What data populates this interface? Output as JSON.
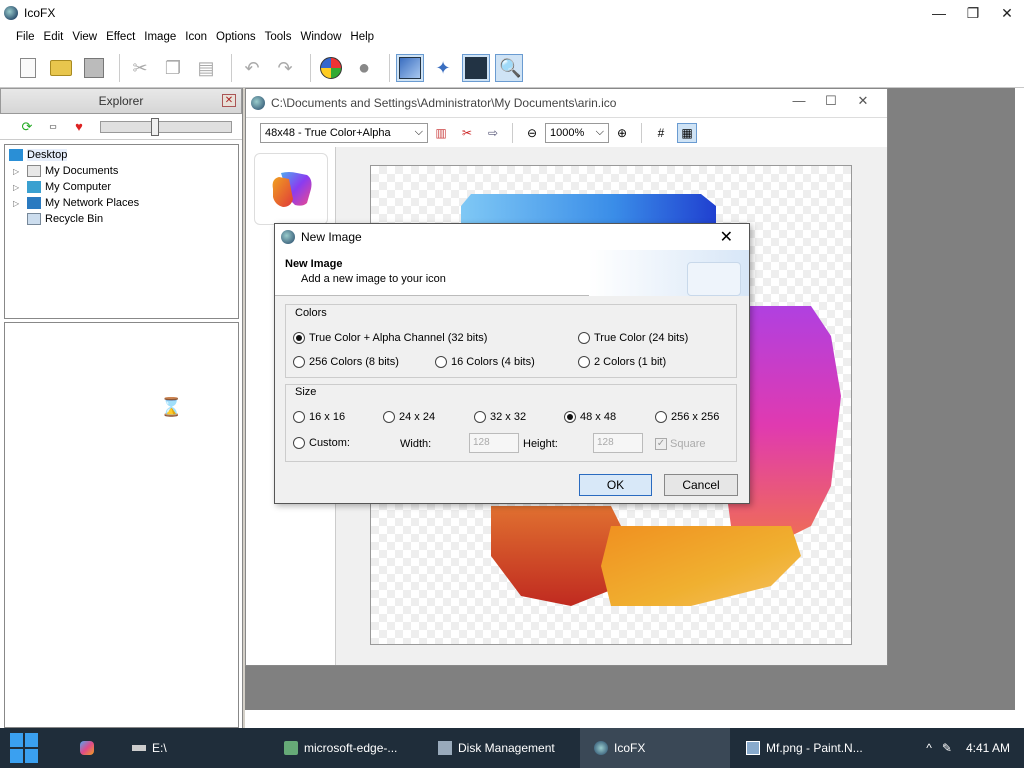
{
  "app": {
    "title": "IcoFX",
    "window_controls": {
      "minimize": "—",
      "maximize": "❐",
      "close": "✕"
    }
  },
  "menu": [
    "File",
    "Edit",
    "View",
    "Effect",
    "Image",
    "Icon",
    "Options",
    "Tools",
    "Window",
    "Help"
  ],
  "toolbar": {
    "icons": [
      "new-icon",
      "open-icon",
      "save-icon",
      "cut-icon",
      "copy-icon",
      "paste-icon",
      "undo-icon",
      "redo-icon",
      "windows-icon",
      "apple-icon",
      "image-view-icon",
      "effect-icon",
      "capture-icon",
      "zoom-icon"
    ]
  },
  "explorer": {
    "title": "Explorer",
    "close": "✕",
    "tree": [
      {
        "label": "Desktop",
        "selected": true
      },
      {
        "label": "My Documents"
      },
      {
        "label": "My Computer"
      },
      {
        "label": "My Network Places"
      },
      {
        "label": "Recycle Bin"
      }
    ]
  },
  "document": {
    "title": "C:\\Documents and Settings\\Administrator\\My Documents\\arin.ico",
    "format": "48x48 - True Color+Alpha",
    "zoom": "1000%",
    "controls": {
      "minimize": "—",
      "maximize": "☐",
      "close": "✕"
    }
  },
  "dialog": {
    "title": "New Image",
    "close": "✕",
    "header_title": "New Image",
    "header_subtitle": "Add a new image to your icon",
    "colors_label": "Colors",
    "colors_options": [
      {
        "label": "True Color + Alpha Channel (32 bits)",
        "selected": true
      },
      {
        "label": "True Color (24 bits)",
        "selected": false
      },
      {
        "label": "256 Colors (8 bits)",
        "selected": false
      },
      {
        "label": "16 Colors (4 bits)",
        "selected": false
      },
      {
        "label": "2 Colors (1 bit)",
        "selected": false
      }
    ],
    "size_label": "Size",
    "size_options": [
      {
        "label": "16 x 16",
        "selected": false
      },
      {
        "label": "24 x 24",
        "selected": false
      },
      {
        "label": "32 x 32",
        "selected": false
      },
      {
        "label": "48 x 48",
        "selected": true
      },
      {
        "label": "256 x 256",
        "selected": false
      },
      {
        "label": "Custom:",
        "selected": false
      }
    ],
    "width_label": "Width:",
    "width_value": "128",
    "height_label": "Height:",
    "height_value": "128",
    "square_label": "Square",
    "ok": "OK",
    "cancel": "Cancel"
  },
  "taskbar": {
    "items": [
      {
        "label": "E:\\"
      },
      {
        "label": "microsoft-edge-..."
      },
      {
        "label": "Disk Management"
      },
      {
        "label": "IcoFX",
        "active": true
      },
      {
        "label": "Mf.png - Paint.N..."
      }
    ],
    "clock": "4:41 AM",
    "tray": "^"
  }
}
